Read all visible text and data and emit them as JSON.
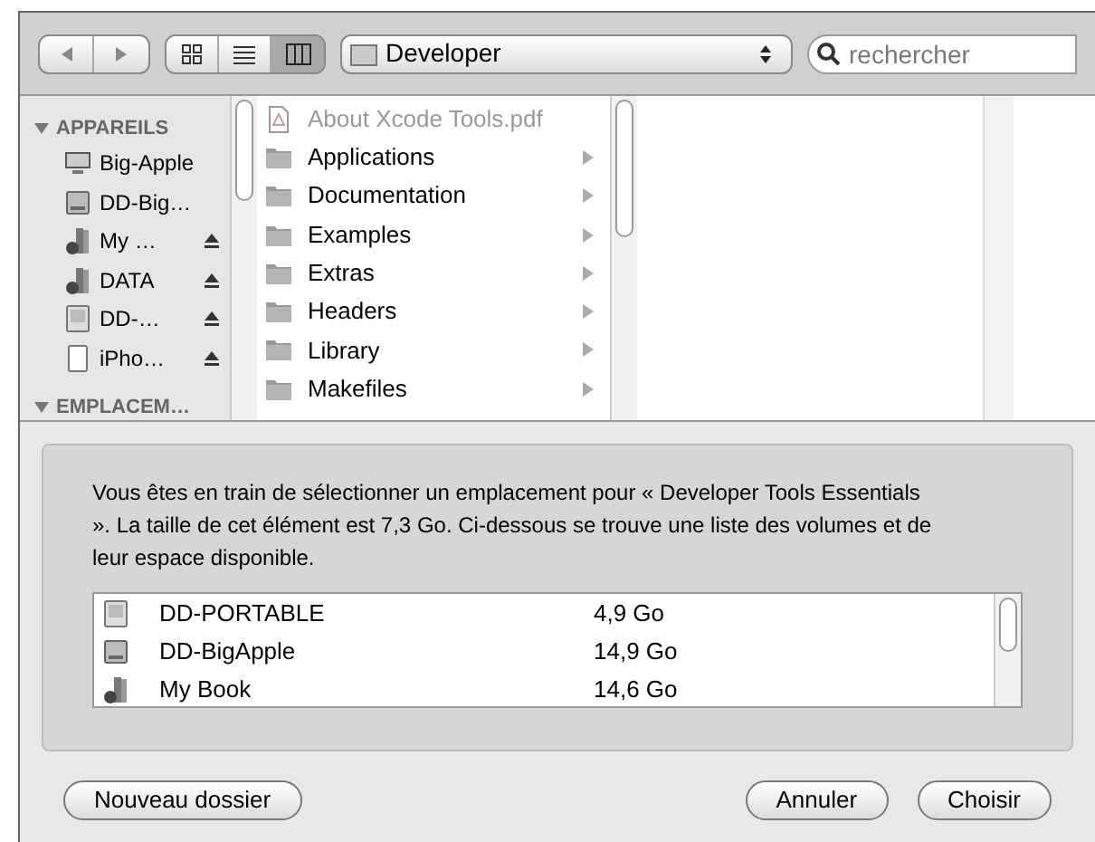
{
  "toolbar": {
    "location": "Developer",
    "search": {
      "placeholder": "rechercher"
    },
    "view_modes": [
      {
        "kind": "icons",
        "selected": false
      },
      {
        "kind": "list",
        "selected": false
      },
      {
        "kind": "columns",
        "selected": true
      }
    ]
  },
  "sidebar": {
    "sections": [
      {
        "title": "APPAREILS",
        "items": [
          {
            "label": "Big-Apple",
            "kind": "computer",
            "ejectable": false
          },
          {
            "label": "DD-Big…",
            "kind": "disk",
            "ejectable": false
          },
          {
            "label": "My …",
            "kind": "external",
            "ejectable": true
          },
          {
            "label": "DATA",
            "kind": "external",
            "ejectable": true
          },
          {
            "label": "DD-…",
            "kind": "image",
            "ejectable": true
          },
          {
            "label": "iPho…",
            "kind": "device",
            "ejectable": true
          }
        ]
      },
      {
        "title": "EMPLACEM…"
      }
    ]
  },
  "column": {
    "items": [
      {
        "name": "About Xcode Tools.pdf",
        "kind": "pdf",
        "disabled": true
      },
      {
        "name": "Applications",
        "kind": "folder",
        "disabled": false
      },
      {
        "name": "Documentation",
        "kind": "folder",
        "disabled": false
      },
      {
        "name": "Examples",
        "kind": "folder",
        "disabled": false
      },
      {
        "name": "Extras",
        "kind": "folder",
        "disabled": false
      },
      {
        "name": "Headers",
        "kind": "folder",
        "disabled": false
      },
      {
        "name": "Library",
        "kind": "folder",
        "disabled": false
      },
      {
        "name": "Makefiles",
        "kind": "folder",
        "disabled": false
      }
    ]
  },
  "message": "Vous êtes en train de sélectionner un emplacement pour « Developer Tools Essentials ». La taille de cet élément est 7,3 Go. Ci-dessous se trouve une liste des volumes et de leur espace disponible.",
  "volumes": [
    {
      "name": "DD-PORTABLE",
      "free": "4,9 Go",
      "kind": "image"
    },
    {
      "name": "DD-BigApple",
      "free": "14,9 Go",
      "kind": "disk"
    },
    {
      "name": "My Book",
      "free": "14,6 Go",
      "kind": "external"
    }
  ],
  "buttons": {
    "new_folder": "Nouveau dossier",
    "cancel": "Annuler",
    "choose": "Choisir"
  }
}
